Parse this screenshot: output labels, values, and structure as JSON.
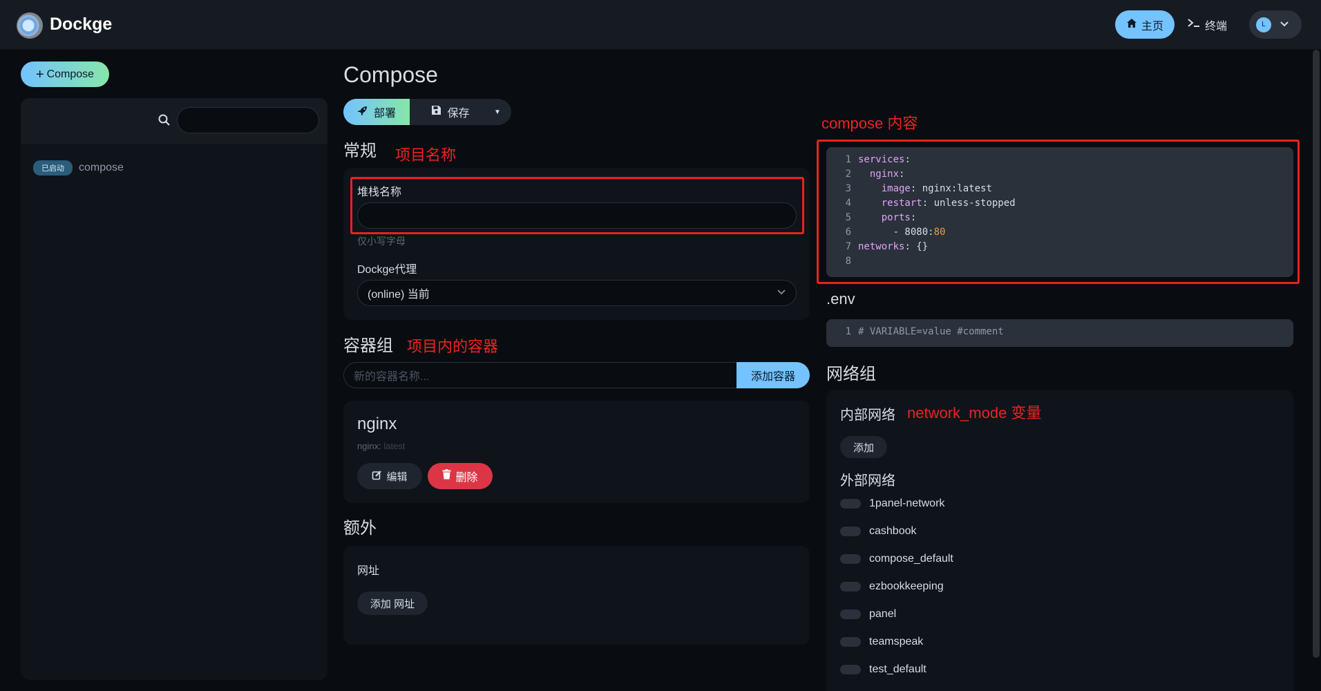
{
  "header": {
    "brand": "Dockge",
    "home_label": "主页",
    "terminal_label": "终端",
    "avatar_initial": "L"
  },
  "sidebar": {
    "compose_button": "Compose",
    "stacks": [
      {
        "status": "已启动",
        "name": "compose"
      }
    ]
  },
  "main": {
    "title": "Compose",
    "deploy_label": "部署",
    "save_label": "保存",
    "general": {
      "title": "常规",
      "annotation": "项目名称",
      "stack_name_label": "堆栈名称",
      "stack_name_value": "",
      "stack_name_hint": "仅小写字母",
      "agent_label": "Dockge代理",
      "agent_value": "(online) 当前"
    },
    "containers": {
      "title": "容器组",
      "annotation": "项目内的容器",
      "new_placeholder": "新的容器名称...",
      "add_label": "添加容器",
      "items": [
        {
          "name": "nginx",
          "image_name": "nginx:",
          "image_tag": "latest",
          "edit_label": "编辑",
          "delete_label": "删除"
        }
      ]
    },
    "extra": {
      "title": "额外",
      "url_label": "网址",
      "add_url_label": "添加 网址"
    }
  },
  "right": {
    "compose_annotation": "compose 内容",
    "compose_lines": [
      {
        "no": "1",
        "indent": "",
        "key": "services",
        "sep": ":",
        "val": "",
        "num": ""
      },
      {
        "no": "2",
        "indent": "  ",
        "key": "nginx",
        "sep": ":",
        "val": "",
        "num": ""
      },
      {
        "no": "3",
        "indent": "    ",
        "key": "image",
        "sep": ": ",
        "val": "nginx:latest",
        "num": ""
      },
      {
        "no": "4",
        "indent": "    ",
        "key": "restart",
        "sep": ": ",
        "val": "unless-stopped",
        "num": ""
      },
      {
        "no": "5",
        "indent": "    ",
        "key": "ports",
        "sep": ":",
        "val": "",
        "num": ""
      },
      {
        "no": "6",
        "indent": "      ",
        "key": "",
        "sep": "",
        "val": "- 8080:",
        "num": "80"
      },
      {
        "no": "7",
        "indent": "",
        "key": "networks",
        "sep": ": ",
        "val": "{}",
        "num": ""
      },
      {
        "no": "8",
        "indent": "",
        "key": "",
        "sep": "",
        "val": "",
        "num": ""
      }
    ],
    "env_title": ".env",
    "env_line": {
      "no": "1",
      "text": "# VARIABLE=value #comment"
    },
    "networks": {
      "title": "网络组",
      "internal_label": "内部网络",
      "annotation": "network_mode 变量",
      "add_label": "添加",
      "external_label": "外部网络",
      "external": [
        "1panel-network",
        "cashbook",
        "compose_default",
        "ezbookkeeping",
        "panel",
        "teamspeak",
        "test_default"
      ]
    }
  }
}
